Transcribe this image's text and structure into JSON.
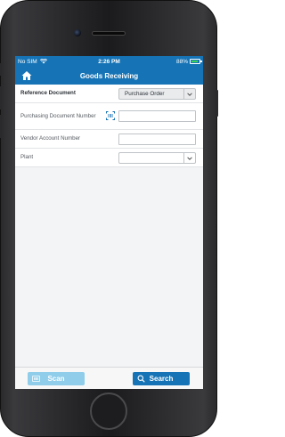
{
  "status_bar": {
    "carrier": "No SIM",
    "time": "2:26 PM",
    "battery": "88%",
    "battery_level": 0.88,
    "icons": [
      "wifi-icon",
      "battery-icon"
    ]
  },
  "nav": {
    "title": "Goods Receiving",
    "home_icon": "home-icon"
  },
  "form": {
    "reference_document": {
      "label": "Reference Document",
      "value": "Purchase Order"
    },
    "purchasing_document": {
      "label": "Purchasing Document Number",
      "value": "",
      "scan_icon": "barcode-icon"
    },
    "vendor_account": {
      "label": "Vendor Account Number",
      "value": ""
    },
    "plant": {
      "label": "Plant",
      "value": ""
    }
  },
  "footer": {
    "scan_label": "Scan",
    "search_label": "Search"
  },
  "colors": {
    "brand_blue": "#1674b6",
    "scan_button": "#8fcdea",
    "battery_green": "#3cd35b"
  }
}
